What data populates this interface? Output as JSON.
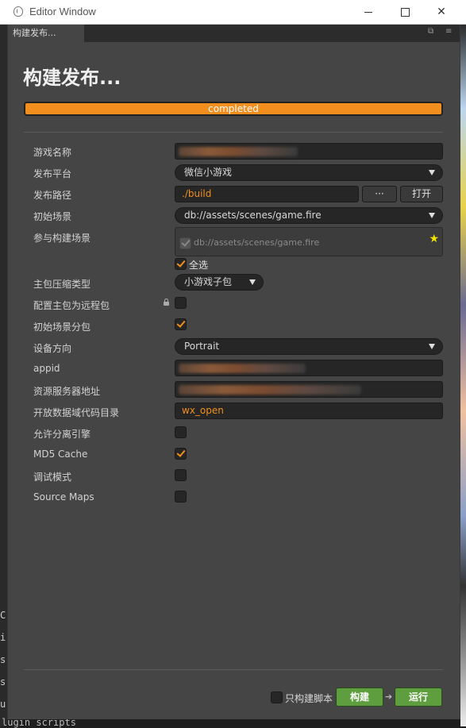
{
  "window": {
    "title": "Editor Window",
    "minimize_glyph": "",
    "maximize_glyph": "",
    "close_glyph": "✕"
  },
  "tab": {
    "label": "构建发布...",
    "restore_glyph": "⧉",
    "menu_glyph": "≡"
  },
  "heading": "构建发布...",
  "progress": {
    "text": "completed",
    "fraction": 1.0
  },
  "form": {
    "game_name": {
      "label": "游戏名称"
    },
    "platform": {
      "label": "发布平台",
      "value": "微信小游戏"
    },
    "build_path": {
      "label": "发布路径",
      "value": "./build",
      "browse_label": "···",
      "open_label": "打开"
    },
    "start_scene": {
      "label": "初始场景",
      "value": "db://assets/scenes/game.fire"
    },
    "included_scenes": {
      "label": "参与构建场景",
      "scene": "db://assets/scenes/game.fire",
      "select_all": "全选"
    },
    "main_compression": {
      "label": "主包压缩类型",
      "value": "小游戏子包"
    },
    "main_remote": {
      "label": "配置主包为远程包"
    },
    "start_scene_subpackage": {
      "label": "初始场景分包"
    },
    "orientation": {
      "label": "设备方向",
      "value": "Portrait"
    },
    "appid": {
      "label": "appid"
    },
    "remote_server": {
      "label": "资源服务器地址"
    },
    "open_data_dir": {
      "label": "开放数据域代码目录",
      "value": "wx_open"
    },
    "separate_engine": {
      "label": "允许分离引擎"
    },
    "md5_cache": {
      "label": "MD5 Cache"
    },
    "debug_mode": {
      "label": "调试模式"
    },
    "source_maps": {
      "label": "Source Maps"
    }
  },
  "footer": {
    "only_script_label": "只构建脚本",
    "build_label": "构建",
    "run_label": "运行",
    "arrow_glyph": "➔"
  },
  "background": {
    "left_glyphs": [
      "C",
      "i",
      "s",
      "s",
      "u"
    ],
    "bottom_code": "lugin scripts"
  },
  "checks": {
    "select_all": true,
    "main_remote": false,
    "start_scene_subpackage": true,
    "separate_engine": false,
    "md5_cache": true,
    "debug_mode": false,
    "source_maps": false,
    "only_script": false
  },
  "colors": {
    "accent": "#f18e1e",
    "panel": "#454545",
    "field": "#262626",
    "build_button": "#5f9e3f",
    "star": "#f5e600"
  }
}
